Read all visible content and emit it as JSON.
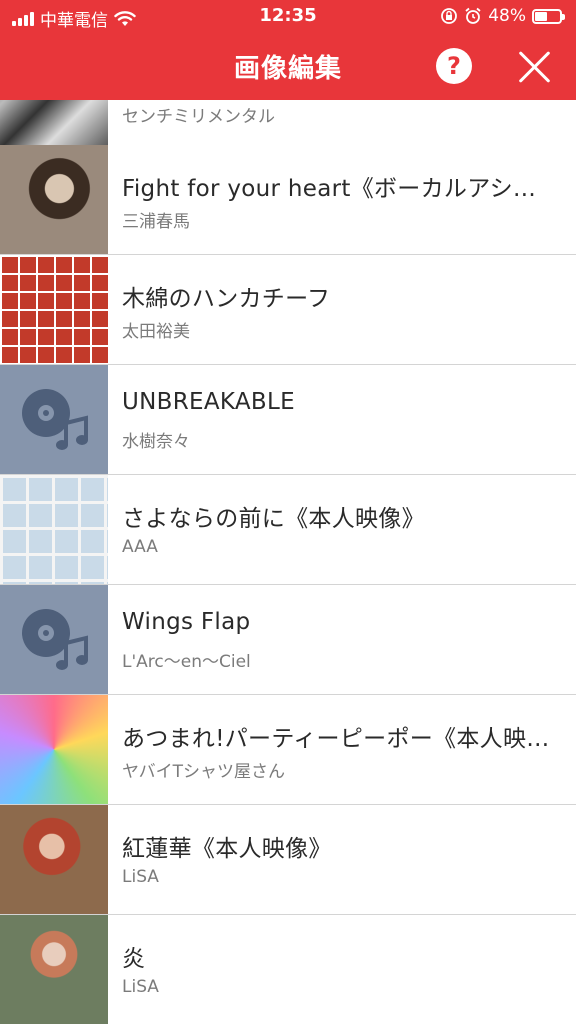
{
  "status_bar": {
    "carrier": "中華電信",
    "time": "12:35",
    "battery": "48%"
  },
  "nav": {
    "title": "画像編集",
    "help_icon": "?"
  },
  "songs": [
    {
      "title": "",
      "artist": "センチミリメンタル"
    },
    {
      "title": "Fight for your heart《ボーカルアシ…",
      "artist": "三浦春馬"
    },
    {
      "title": "木綿のハンカチーフ",
      "artist": "太田裕美"
    },
    {
      "title": "UNBREAKABLE",
      "artist": "水樹奈々"
    },
    {
      "title": "さよならの前に《本人映像》",
      "artist": "AAA"
    },
    {
      "title": "Wings Flap",
      "artist": "L'Arc〜en〜Ciel"
    },
    {
      "title": "あつまれ!パーティーピーポー《本人映…",
      "artist": "ヤバイTシャツ屋さん"
    },
    {
      "title": "紅蓮華《本人映像》",
      "artist": "LiSA"
    },
    {
      "title": "炎",
      "artist": "LiSA"
    }
  ],
  "colors": {
    "accent": "#e8363a",
    "placeholder": "#8695ac"
  },
  "icons": [
    "wifi-icon",
    "lock-rotation-icon",
    "alarm-icon",
    "battery-icon",
    "help-icon",
    "close-icon",
    "music-disc-icon"
  ]
}
